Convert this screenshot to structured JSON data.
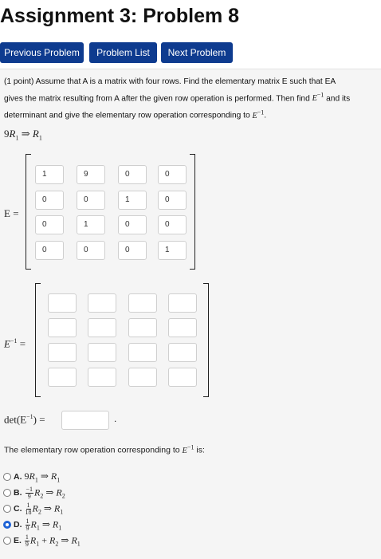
{
  "title": "Assignment 3: Problem 8",
  "nav": {
    "previous": "Previous Problem",
    "list": "Problem List",
    "next": "Next Problem"
  },
  "problem": {
    "points": "(1 point)",
    "text_1": "Assume that A is a matrix with four rows. Find the elementary matrix E such that EA gives the matrix resulting from A after the given row operation is performed. Then find ",
    "text_2": " and its determinant and give the elementary row operation corresponding to ",
    "einv": "E",
    "op_coef": "9",
    "op_arrow": "⇒",
    "op_r": "R"
  },
  "E_label": "E =",
  "Einv_label": "E",
  "E_matrix": [
    [
      "1",
      "9",
      "0",
      "0"
    ],
    [
      "0",
      "0",
      "1",
      "0"
    ],
    [
      "0",
      "1",
      "0",
      "0"
    ],
    [
      "0",
      "0",
      "0",
      "1"
    ]
  ],
  "det_label": "det(E",
  "det_value": "",
  "question_1": "The elementary row operation corresponding to ",
  "question_2": " is:",
  "options": [
    {
      "letter": "A.",
      "selected": false
    },
    {
      "letter": "B.",
      "selected": false
    },
    {
      "letter": "C.",
      "selected": false
    },
    {
      "letter": "D.",
      "selected": true
    },
    {
      "letter": "E.",
      "selected": false
    }
  ],
  "colors": {
    "nav_button": "#0e3b8f",
    "panel_bg": "#f5f5f5",
    "radio_selected": "#1e63d6"
  }
}
